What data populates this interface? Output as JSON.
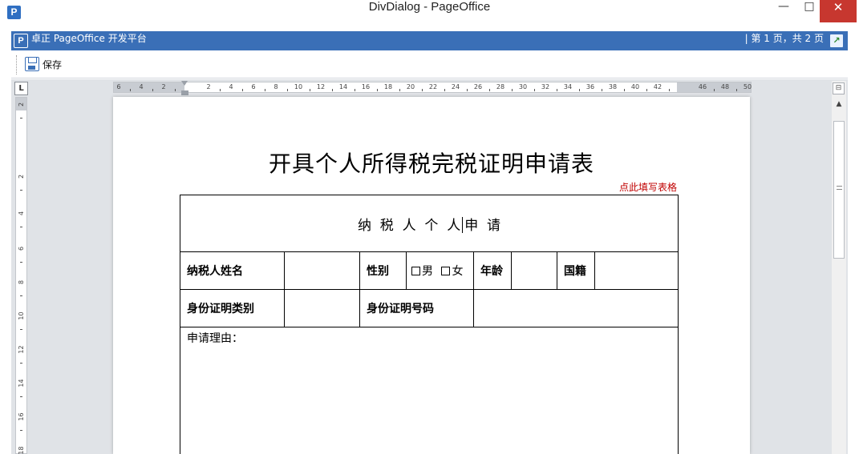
{
  "window": {
    "title": "DivDialog - PageOffice",
    "app_icon_letter": "P",
    "min_glyph": "—",
    "max_glyph": "□",
    "close_glyph": "✕"
  },
  "pageoffice_bar": {
    "logo_glyph": "P",
    "title": "卓正 PageOffice 开发平台",
    "page_info": "| 第 1 页，共 2 页",
    "fullscreen_glyph": "↗",
    "bar_color": "#3a6fb7"
  },
  "toolbar": {
    "save_label": "保存"
  },
  "ruler": {
    "corner_glyph": "L",
    "h_numbers": [
      "6",
      "4",
      "2",
      "2",
      "4",
      "6",
      "8",
      "10",
      "12",
      "14",
      "16",
      "18",
      "20",
      "22",
      "24",
      "26",
      "28",
      "30",
      "32",
      "34",
      "36",
      "38",
      "40",
      "42",
      "46",
      "48",
      "50"
    ],
    "v_numbers": [
      "2",
      "2",
      "4",
      "6",
      "8",
      "10",
      "12",
      "14",
      "16",
      "18"
    ]
  },
  "scrollbar": {
    "split_glyph": "⊟",
    "up_glyph": "▲"
  },
  "document": {
    "title": "开具个人所得税完税证明申请表",
    "fill_link": "点此填写表格",
    "header_row": "纳  税  人  个  人",
    "header_row_tail": "申  请",
    "taxpayer_name_label": "纳税人姓名",
    "gender_label": "性别",
    "gender_male": "男",
    "gender_female": "女",
    "age_label": "年龄",
    "nationality_label": "国籍",
    "id_type_label": "身份证明类别",
    "id_number_label": "身份证明号码",
    "reason_label": "申请理由：",
    "link_color": "#c00000"
  }
}
